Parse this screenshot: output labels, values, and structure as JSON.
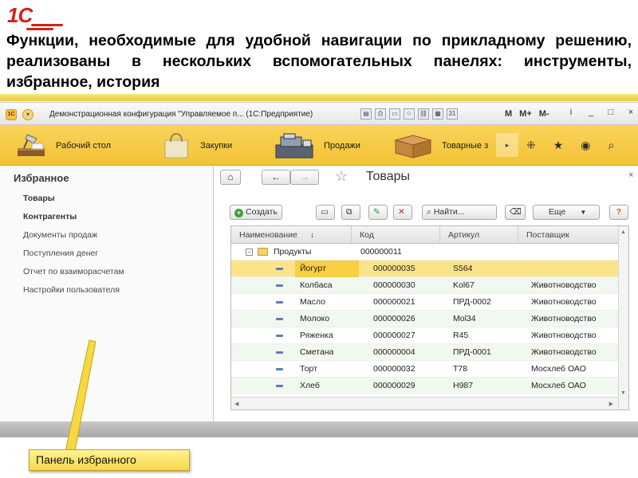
{
  "slide": {
    "logo": "1С",
    "heading": "Функции, необходимые для удобной навигации по прикладному решению, реализованы в нескольких вспомогательных панелях: инструменты, избранное, история"
  },
  "window": {
    "title": "Демонстрационная конфигурация \"Управляемое п... (1С:Предприятие)",
    "memory_buttons": [
      "M",
      "M+",
      "M-"
    ],
    "controls": [
      "i",
      "_",
      "□",
      "×"
    ]
  },
  "sections": [
    {
      "label": "Рабочий стол",
      "icon": "desk-lamp-icon"
    },
    {
      "label": "Закупки",
      "icon": "shopping-bag-icon"
    },
    {
      "label": "Продажи",
      "icon": "cash-register-icon"
    },
    {
      "label": "Товарные з",
      "icon": "box-icon"
    }
  ],
  "favorites": {
    "title": "Избранное",
    "items": [
      {
        "label": "Товары",
        "bold": true
      },
      {
        "label": "Контрагенты",
        "bold": true
      },
      {
        "label": "Документы продаж",
        "bold": false
      },
      {
        "label": "Поступления денег",
        "bold": false
      },
      {
        "label": "Отчет по взаиморасчетам",
        "bold": false
      },
      {
        "label": "Настройки пользователя",
        "bold": false
      }
    ]
  },
  "form": {
    "title": "Товары",
    "create_label": "Создать",
    "find_label": "Найти...",
    "more_label": "Еще",
    "help_label": "?"
  },
  "table": {
    "columns": [
      "Наименование",
      "Код",
      "Артикул",
      "Поставщик"
    ],
    "sort_mark": "↓",
    "group": {
      "name": "Продукты",
      "code": "000000011"
    },
    "rows": [
      {
        "name": "Йогурт",
        "code": "000000035",
        "article": "S564",
        "supplier": ""
      },
      {
        "name": "Колбаса",
        "code": "000000030",
        "article": "Kol67",
        "supplier": "Животноводство"
      },
      {
        "name": "Масло",
        "code": "000000021",
        "article": "ПРД-0002",
        "supplier": "Животноводство"
      },
      {
        "name": "Молоко",
        "code": "000000026",
        "article": "Mol34",
        "supplier": "Животноводство"
      },
      {
        "name": "Ряженка",
        "code": "000000027",
        "article": "R45",
        "supplier": "Животноводство"
      },
      {
        "name": "Сметана",
        "code": "000000004",
        "article": "ПРД-0001",
        "supplier": "Животноводство"
      },
      {
        "name": "Торт",
        "code": "000000032",
        "article": "T78",
        "supplier": "Мосхлеб ОАО"
      },
      {
        "name": "Хлеб",
        "code": "000000029",
        "article": "H987",
        "supplier": "Мосхлеб ОАО"
      }
    ]
  },
  "callout": {
    "label": "Панель избранного"
  },
  "colors": {
    "accent_yellow": "#f3c234",
    "selected_row": "#fbe38a",
    "logo_red": "#d3201b"
  }
}
